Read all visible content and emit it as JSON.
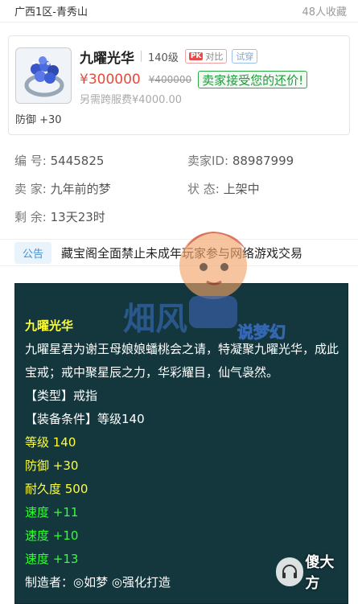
{
  "header": {
    "server": "广西1区-青秀山",
    "favorites": "48人收藏"
  },
  "item": {
    "name": "九曜光华",
    "level": "140级",
    "compare_label": "对比",
    "compare_badge": "PK",
    "try_label": "试穿",
    "price": "¥300000",
    "original_price": "¥400000",
    "bargain_text": "卖家接受您的还价!",
    "service_fee": "另需跨服费¥4000.00",
    "defense": "防御 +30"
  },
  "details": {
    "id_label": "编  号:",
    "id_value": "5445825",
    "seller_id_label": "卖家ID:",
    "seller_id_value": "88987999",
    "seller_label": "卖  家:",
    "seller_value": "九年前的梦",
    "status_label": "状  态:",
    "status_value": "上架中",
    "remain_label": "剩  余:",
    "remain_value": "13天23时"
  },
  "notice": {
    "badge": "公告",
    "text": "藏宝阁全面禁止未成年玩家参与网络游戏交易"
  },
  "description": {
    "title": "九曜光华",
    "lore": "九曜星君为谢王母娘娘蟠桃会之请，特凝聚九曜光华，成此宝戒；戒中聚星辰之力，华彩耀目，仙气袅然。",
    "type_line": "【类型】戒指",
    "req_line": "【装备条件】等级140",
    "level_line": "等级 140",
    "defense_line": "防御 +30",
    "durability_line": "耐久度 500",
    "speed1": "速度 +11",
    "speed2": "速度 +10",
    "speed3": "速度 +13",
    "maker_line": "制造者：◎如梦  ◎强化打造"
  },
  "watermark": {
    "text": "说梦幻"
  },
  "corner_logo": {
    "text": "傻大方"
  },
  "colors": {
    "price": "#e54a3a",
    "bargain": "#1e9a3c",
    "panel_bg": "#14373e",
    "yellow": "#ffff33",
    "green": "#33ff33"
  }
}
